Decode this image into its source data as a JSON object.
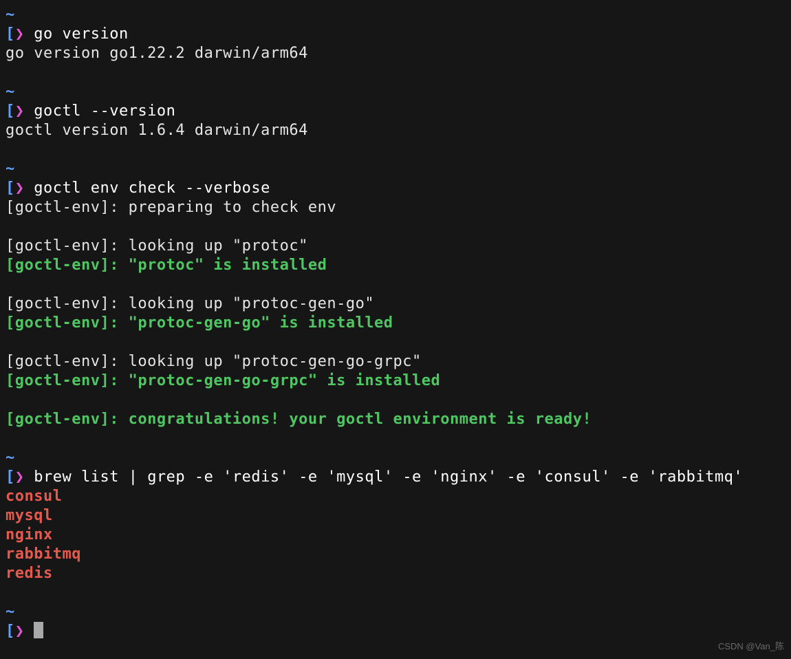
{
  "prompt": {
    "tilde": "~",
    "lbracket": "❯",
    "arrow": "❯"
  },
  "blocks": [
    {
      "cmd": "go version",
      "out": [
        {
          "text": "go version go1.22.2 darwin/arm64",
          "cls": "out"
        }
      ]
    },
    {
      "cmd": "goctl --version",
      "out": [
        {
          "text": "goctl version 1.6.4 darwin/arm64",
          "cls": "out"
        }
      ]
    },
    {
      "cmd": "goctl env check --verbose",
      "out": [
        {
          "text": "[goctl-env]: preparing to check env",
          "cls": "out"
        },
        {
          "text": "",
          "cls": "out"
        },
        {
          "text": "[goctl-env]: looking up \"protoc\"",
          "cls": "out"
        },
        {
          "text": "[goctl-env]: \"protoc\" is installed",
          "cls": "green"
        },
        {
          "text": "",
          "cls": "out"
        },
        {
          "text": "[goctl-env]: looking up \"protoc-gen-go\"",
          "cls": "out"
        },
        {
          "text": "[goctl-env]: \"protoc-gen-go\" is installed",
          "cls": "green"
        },
        {
          "text": "",
          "cls": "out"
        },
        {
          "text": "[goctl-env]: looking up \"protoc-gen-go-grpc\"",
          "cls": "out"
        },
        {
          "text": "[goctl-env]: \"protoc-gen-go-grpc\" is installed",
          "cls": "green"
        },
        {
          "text": "",
          "cls": "out"
        },
        {
          "text": "[goctl-env]: congratulations! your goctl environment is ready!",
          "cls": "green"
        }
      ]
    },
    {
      "cmd": "brew list | grep -e 'redis' -e 'mysql' -e 'nginx' -e 'consul' -e 'rabbitmq'",
      "out": [
        {
          "text": "consul",
          "cls": "red"
        },
        {
          "text": "mysql",
          "cls": "red"
        },
        {
          "text": "nginx",
          "cls": "red"
        },
        {
          "text": "rabbitmq",
          "cls": "red"
        },
        {
          "text": "redis",
          "cls": "red"
        }
      ]
    }
  ],
  "watermark": "CSDN @Van_陈"
}
